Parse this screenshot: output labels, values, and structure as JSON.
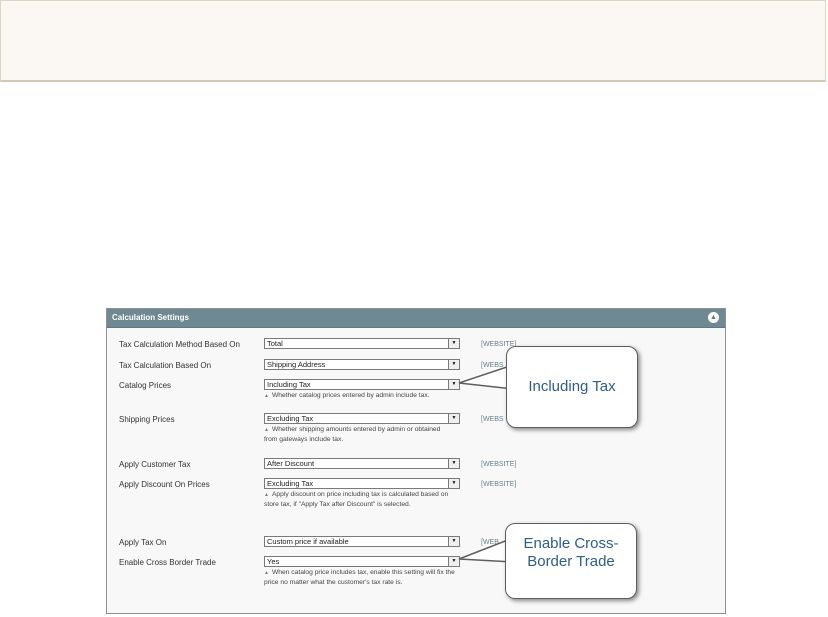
{
  "panel": {
    "title": "Calculation Settings",
    "collapse_icon": "▲"
  },
  "rows": [
    {
      "label": "Tax Calculation Method Based On",
      "value": "Total",
      "scope": "[WEBSITE]",
      "note": ""
    },
    {
      "label": "Tax Calculation Based On",
      "value": "Shipping Address",
      "scope": "[WEBS",
      "note": ""
    },
    {
      "label": "Catalog Prices",
      "value": "Including Tax",
      "scope": "",
      "note": "Whether catalog prices entered by admin include tax."
    },
    {
      "label": "Shipping Prices",
      "value": "Excluding Tax",
      "scope": "[WEBS",
      "note": "Whether shipping amounts entered by admin or obtained from gateways include tax."
    },
    {
      "label": "Apply Customer Tax",
      "value": "After Discount",
      "scope": "[WEBSITE]",
      "note": ""
    },
    {
      "label": "Apply Discount On Prices",
      "value": "Excluding Tax",
      "scope": "[WEBSITE]",
      "note": "Apply discount on price including tax is calculated based on store tax, if \"Apply Tax after Discount\" is selected."
    },
    {
      "label": "Apply Tax On",
      "value": "Custom price if available",
      "scope": "[WEB",
      "note": ""
    },
    {
      "label": "Enable Cross Border Trade",
      "value": "Yes",
      "scope": "",
      "note": "When catalog price includes tax, enable this setting will fix the price no matter what the customer's tax rate is."
    }
  ],
  "callouts": {
    "including_tax": "Including Tax",
    "cross_border": "Enable Cross-Border Trade"
  },
  "icons": {
    "dropdown": "▼",
    "note_arrow": "▲"
  }
}
